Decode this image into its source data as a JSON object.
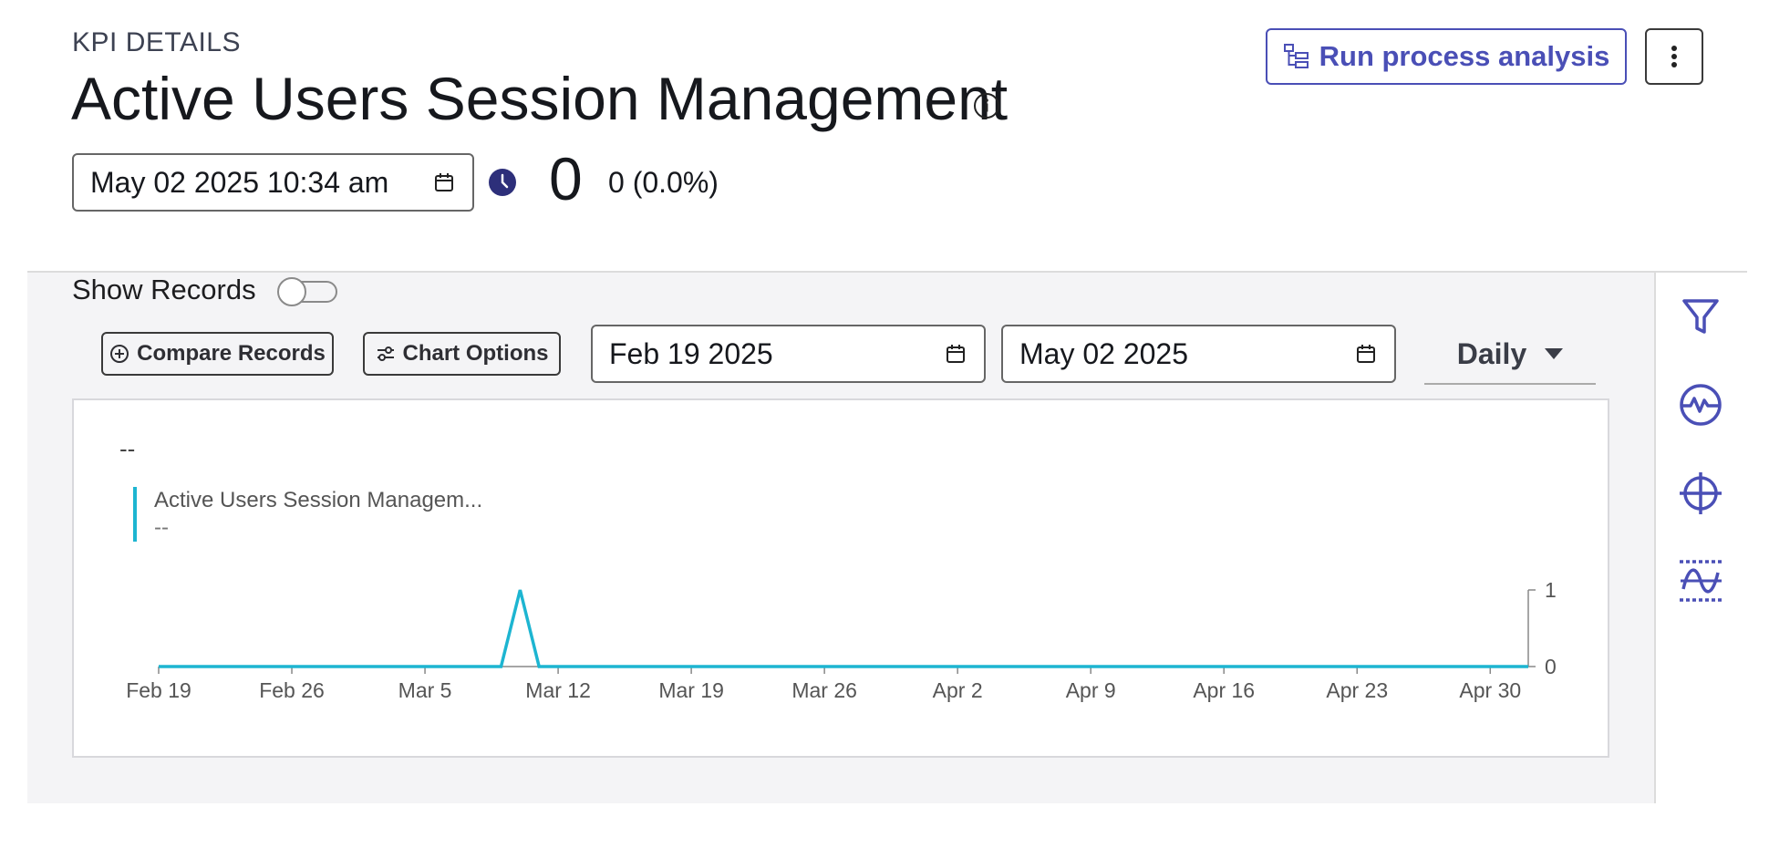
{
  "header": {
    "eyebrow": "KPI DETAILS",
    "title": "Active Users Session Management",
    "run_label": "Run process analysis"
  },
  "kpi": {
    "date": "May 02 2025 10:34 am",
    "value": "0",
    "delta": "0 (0.0%)"
  },
  "records": {
    "show_label": "Show Records",
    "show_enabled": false,
    "compare_label": "Compare Records",
    "options_label": "Chart Options",
    "start_date": "Feb 19 2025",
    "end_date": "May 02 2025",
    "period": "Daily"
  },
  "chart_data": {
    "type": "line",
    "header_value": "--",
    "x": [
      "Feb 19",
      "Feb 26",
      "Mar 5",
      "Mar 12",
      "Mar 19",
      "Mar 26",
      "Apr 2",
      "Apr 9",
      "Apr 16",
      "Apr 23",
      "Apr 30"
    ],
    "series": [
      {
        "name": "Active Users Session Managem...",
        "value_label": "--",
        "color": "#1db5d1",
        "points": [
          {
            "x": "Feb 19",
            "y": 0
          },
          {
            "x": "Mar 9",
            "y": 0
          },
          {
            "x": "Mar 10",
            "y": 1
          },
          {
            "x": "Mar 11",
            "y": 0
          },
          {
            "x": "May 2",
            "y": 0
          }
        ]
      }
    ],
    "y_ticks": [
      "0",
      "1"
    ],
    "ylim": [
      0,
      1
    ],
    "grid": false,
    "legend_position": "top-left",
    "y_axis_side": "right"
  },
  "colors": {
    "accent": "#4a4fb6",
    "series": "#1db5d1",
    "clock": "#2d2f7a"
  },
  "icons": {
    "side": [
      "filter-icon",
      "pulse-icon",
      "target-icon",
      "threshold-icon"
    ]
  }
}
